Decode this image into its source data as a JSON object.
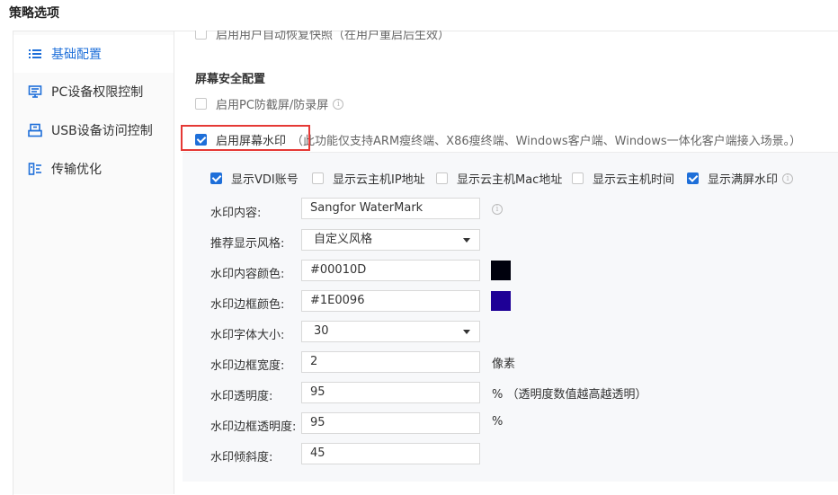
{
  "header": {
    "title": "策略选项"
  },
  "sidebar": {
    "items": [
      {
        "label": "基础配置",
        "icon": "list-icon",
        "active": true
      },
      {
        "label": "PC设备权限控制",
        "icon": "monitor-icon",
        "active": false
      },
      {
        "label": "USB设备访问控制",
        "icon": "usb-device-icon",
        "active": false
      },
      {
        "label": "传输优化",
        "icon": "transfer-icon",
        "active": false
      }
    ]
  },
  "main": {
    "top_option": {
      "label": "启用用户自动恢复快照（在用户重启后生效）",
      "checked": false
    },
    "screen_security": {
      "title": "屏幕安全配置",
      "anti_capture": {
        "label": "启用PC防截屏/防录屏",
        "checked": false
      },
      "watermark": {
        "label": "启用屏幕水印",
        "checked": true,
        "note": "（此功能仅支持ARM瘦终端、X86瘦终端、Windows客户端、Windows一体化客户端接入场景。）"
      }
    },
    "watermark_panel": {
      "options": [
        {
          "label": "显示VDI账号",
          "checked": true
        },
        {
          "label": "显示云主机IP地址",
          "checked": false
        },
        {
          "label": "显示云主机Mac地址",
          "checked": false
        },
        {
          "label": "显示云主机时间",
          "checked": false
        },
        {
          "label": "显示满屏水印",
          "checked": true
        }
      ],
      "fields": {
        "content": {
          "label": "水印内容:",
          "value": "Sangfor WaterMark"
        },
        "style": {
          "label": "推荐显示风格:",
          "value": "自定义风格"
        },
        "content_color": {
          "label": "水印内容颜色:",
          "value": "#00010D",
          "swatch": "#00010D"
        },
        "border_color": {
          "label": "水印边框颜色:",
          "value": "#1E0096",
          "swatch": "#1E0096"
        },
        "font_size": {
          "label": "水印字体大小:",
          "value": "30"
        },
        "border_width": {
          "label": "水印边框宽度:",
          "value": "2",
          "unit": "像素"
        },
        "opacity": {
          "label": "水印透明度:",
          "value": "95",
          "unit": "%  （透明度数值越高越透明）"
        },
        "border_opacity": {
          "label": "水印边框透明度:",
          "value": "95",
          "unit": "%"
        },
        "tilt": {
          "label": "水印倾斜度:",
          "value": "45"
        }
      }
    }
  },
  "colors": {
    "accent": "#1e6fd9",
    "highlight_box": "#e53935"
  }
}
